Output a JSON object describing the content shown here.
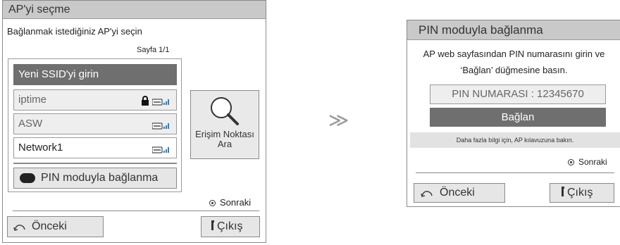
{
  "left_dialog": {
    "title": "AP'yi seçme",
    "instruction": "Bağlanmak istediğiniz AP'yi seçin",
    "page_indicator": "Sayfa 1/1",
    "enter_ssid": "Yeni SSID'yi girin",
    "networks": [
      {
        "name": "iptime",
        "locked": true
      },
      {
        "name": "ASW",
        "locked": false
      },
      {
        "name": "Network1",
        "locked": false
      }
    ],
    "pin_mode_button": "PIN moduyla bağlanma",
    "search_ap_line1": "Erişim Noktası",
    "search_ap_line2": "Ara",
    "next": "Sonraki",
    "back": "Önceki",
    "exit": "Çıkış"
  },
  "arrow": "≫",
  "right_dialog": {
    "title": "PIN moduyla bağlanma",
    "instruction_line1": "AP web sayfasından PIN numarasını girin ve",
    "instruction_line2": "‘Bağlan’ düğmesine basın.",
    "pin_field": "PIN NUMARASI : 12345670",
    "connect_button": "Bağlan",
    "info": "Daha fazla bilgi için, AP kılavuzuna bakın.",
    "next": "Sonraki",
    "back": "Önceki",
    "exit": "Çıkış"
  },
  "colors": {
    "title_bar": "#c9c9c9",
    "selected_row": "#6f6f6f",
    "button_bg": "#e6e6e6",
    "border": "#8a8a8a"
  }
}
